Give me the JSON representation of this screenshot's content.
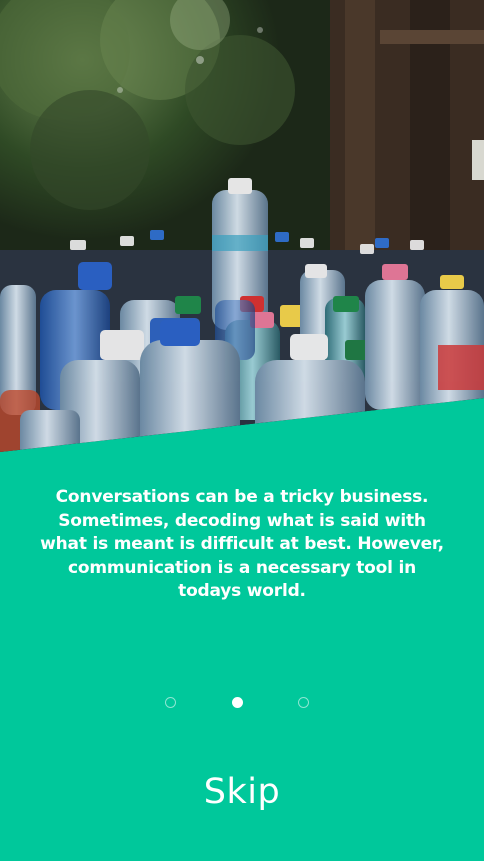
{
  "hero": {
    "image_icon": "plastic-bottles-photo"
  },
  "onboarding": {
    "message": "Conversations can be a tricky business. Sometimes, decoding what is said with what is meant is difficult at best. However, communication is a necessary tool in todays world."
  },
  "pager": {
    "pages": 3,
    "active_index": 1
  },
  "actions": {
    "skip_label": "Skip"
  },
  "colors": {
    "accent": "#00C89B",
    "text": "#FFFFFF"
  }
}
